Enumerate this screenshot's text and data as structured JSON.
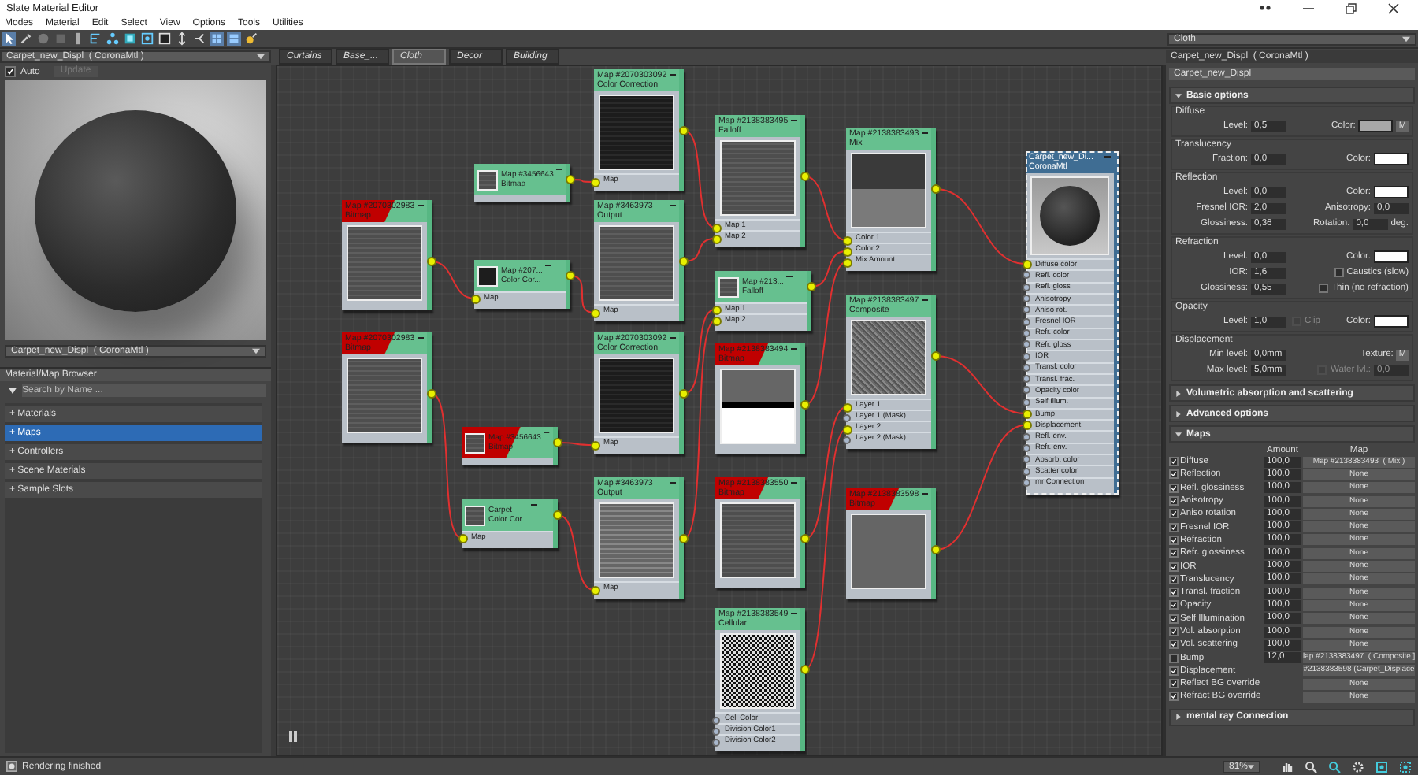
{
  "window": {
    "title": "Slate Material Editor"
  },
  "menu": [
    "Modes",
    "Material",
    "Edit",
    "Select",
    "View",
    "Options",
    "Tools",
    "Utilities"
  ],
  "view_dropdown": "Cloth",
  "material_dropdown": "Carpet_new_Displ  ( CoronaMtl )",
  "view_tabs": [
    {
      "label": "Curtains",
      "selected": false
    },
    {
      "label": "Base_...",
      "selected": false
    },
    {
      "label": "Cloth",
      "selected": true
    },
    {
      "label": "Decor",
      "selected": false
    },
    {
      "label": "Building",
      "selected": false
    }
  ],
  "preview_panel": {
    "auto": {
      "label": "Auto",
      "checked": true
    },
    "update": {
      "label": "Update",
      "disabled": true
    },
    "material_dropdown": "Carpet_new_Displ  ( CoronaMtl )"
  },
  "browser": {
    "title": "Material/Map Browser",
    "search": {
      "placeholder": "Search by Name ..."
    },
    "categories": [
      {
        "label": "+ Materials",
        "selected": false
      },
      {
        "label": "+ Maps",
        "selected": true
      },
      {
        "label": "+ Controllers",
        "selected": false
      },
      {
        "label": "+ Scene Materials",
        "selected": false
      },
      {
        "label": "+ Sample Slots",
        "selected": false
      }
    ]
  },
  "nodes": [
    {
      "title": "Map #2070303092",
      "type": "Color Correction",
      "kind": "large",
      "error": false,
      "selected": false,
      "preview": {
        "kind": "dark"
      },
      "slots": [
        {
          "label": "Map",
          "connected": true
        }
      ]
    },
    {
      "title": "Map #3456643",
      "type": "Bitmap",
      "kind": "small",
      "error": false,
      "selected": false,
      "preview": {
        "kind": "grey"
      }
    },
    {
      "title": "Map #2070302983",
      "type": "Bitmap",
      "kind": "large",
      "error": true,
      "selected": false,
      "preview": {
        "kind": "grey"
      }
    },
    {
      "title": "Map #207...",
      "type": "Color Cor...",
      "kind": "small",
      "error": false,
      "selected": false,
      "preview": {
        "kind": "black"
      },
      "slots": [
        {
          "label": "Map",
          "connected": true
        }
      ]
    },
    {
      "title": "Map #3463973",
      "type": "Output",
      "kind": "large",
      "error": false,
      "selected": false,
      "preview": {
        "kind": "grey"
      },
      "slots": [
        {
          "label": "Map",
          "connected": true
        }
      ]
    },
    {
      "title": "Map #2138383495",
      "type": "Falloff",
      "kind": "large",
      "error": false,
      "selected": false,
      "preview": {
        "kind": "grey"
      },
      "slots": [
        {
          "label": "Map 1",
          "connected": true
        },
        {
          "label": "Map 2",
          "connected": true
        }
      ]
    },
    {
      "title": "Map #213...",
      "type": "Falloff",
      "kind": "small",
      "error": false,
      "selected": false,
      "preview": {
        "kind": "grey"
      },
      "slots": [
        {
          "label": "Map 1",
          "connected": true
        },
        {
          "label": "Map 2",
          "connected": true
        }
      ]
    },
    {
      "title": "Map #2138383493",
      "type": "Mix",
      "kind": "large",
      "error": false,
      "selected": false,
      "preview": {
        "kind": "mix"
      },
      "slots": [
        {
          "label": "Color 1",
          "connected": true
        },
        {
          "label": "Color 2",
          "connected": true
        },
        {
          "label": "Mix Amount",
          "connected": true
        }
      ]
    },
    {
      "title": "Map #2070302983",
      "type": "Bitmap",
      "kind": "large",
      "error": true,
      "selected": false,
      "preview": {
        "kind": "grey"
      }
    },
    {
      "title": "Map #2070303092",
      "type": "Color Correction",
      "kind": "large",
      "error": false,
      "selected": false,
      "preview": {
        "kind": "dark"
      },
      "slots": [
        {
          "label": "Map",
          "connected": true
        }
      ]
    },
    {
      "title": "Map #2138383494",
      "type": "Bitmap",
      "kind": "large",
      "error": true,
      "selected": false,
      "preview": {
        "kind": "half"
      }
    },
    {
      "title": "Map #2138383497",
      "type": "Composite",
      "kind": "large",
      "error": false,
      "selected": false,
      "preview": {
        "kind": "noise"
      },
      "slots": [
        {
          "label": "Layer 1",
          "connected": true
        },
        {
          "label": "Layer 1 (Mask)",
          "connected": false
        },
        {
          "label": "Layer 2",
          "connected": true
        },
        {
          "label": "Layer 2 (Mask)",
          "connected": false
        }
      ]
    },
    {
      "title": "Map #3456643",
      "type": "Bitmap",
      "kind": "small",
      "error": true,
      "selected": false,
      "preview": {
        "kind": "grey"
      }
    },
    {
      "title": "Carpet",
      "type": "Color Cor...",
      "kind": "small",
      "error": false,
      "selected": false,
      "preview": {
        "kind": "grey"
      },
      "slots": [
        {
          "label": "Map",
          "connected": true
        }
      ]
    },
    {
      "title": "Map #3463973",
      "type": "Output",
      "kind": "large",
      "error": false,
      "selected": false,
      "preview": {
        "kind": "light"
      },
      "slots": [
        {
          "label": "Map",
          "connected": true
        }
      ]
    },
    {
      "title": "Map #2138383550",
      "type": "Bitmap",
      "kind": "large",
      "error": true,
      "selected": false,
      "preview": {
        "kind": "grey"
      }
    },
    {
      "title": "Map #2138383598",
      "type": "Bitmap",
      "kind": "large",
      "error": true,
      "selected": false,
      "preview": {
        "kind": "flat"
      }
    },
    {
      "title": "Map #2138383549",
      "type": "Cellular",
      "kind": "large",
      "error": false,
      "selected": false,
      "preview": {
        "kind": "cells"
      },
      "slots": [
        {
          "label": "Cell Color",
          "connected": false
        },
        {
          "label": "Division Color1",
          "connected": false
        },
        {
          "label": "Division Color2",
          "connected": false
        }
      ]
    },
    {
      "title": "Carpet_new_Di...",
      "type": "CoronaMtl",
      "kind": "material",
      "error": false,
      "selected": true,
      "preview": {
        "kind": "sphere"
      },
      "slots": [
        {
          "label": "Diffuse color",
          "connected": true
        },
        {
          "label": "Refl. color",
          "connected": false
        },
        {
          "label": "Refl. gloss",
          "connected": false
        },
        {
          "label": "Anisotropy",
          "connected": false
        },
        {
          "label": "Aniso rot.",
          "connected": false
        },
        {
          "label": "Fresnel IOR",
          "connected": false
        },
        {
          "label": "Refr. color",
          "connected": false
        },
        {
          "label": "Refr. gloss",
          "connected": false
        },
        {
          "label": "IOR",
          "connected": false
        },
        {
          "label": "Transl. color",
          "connected": false
        },
        {
          "label": "Transl. frac.",
          "connected": false
        },
        {
          "label": "Opacity color",
          "connected": false
        },
        {
          "label": "Self Illum.",
          "connected": false
        },
        {
          "label": "Bump",
          "connected": true
        },
        {
          "label": "Displacement",
          "connected": true
        },
        {
          "label": "Refl. env.",
          "connected": false
        },
        {
          "label": "Refr. env.",
          "connected": false
        },
        {
          "label": "Absorb. color",
          "connected": false
        },
        {
          "label": "Scatter color",
          "connected": false
        },
        {
          "label": "mr Connection",
          "connected": false
        }
      ]
    }
  ],
  "parameters": {
    "header": "Carpet_new_Displ  ( CoronaMtl )",
    "name": "Carpet_new_Displ",
    "basic": {
      "title": "Basic options",
      "expanded": true,
      "groups": [
        {
          "title": "Diffuse",
          "rows": [
            [
              {
                "kind": "spinner",
                "label": "Level:",
                "value": "0,5"
              },
              {
                "kind": "color",
                "label": "Color:",
                "color": "#a8a8a8",
                "map": "M"
              }
            ]
          ]
        },
        {
          "title": "Translucency",
          "rows": [
            [
              {
                "kind": "spinner",
                "label": "Fraction:",
                "value": "0,0"
              },
              {
                "kind": "color",
                "label": "Color:",
                "color": "#ffffff"
              }
            ]
          ]
        },
        {
          "title": "Reflection",
          "rows": [
            [
              {
                "kind": "spinner",
                "label": "Level:",
                "value": "0,0"
              },
              {
                "kind": "color",
                "label": "Color:",
                "color": "#ffffff"
              }
            ],
            [
              {
                "kind": "spinner",
                "label": "Fresnel IOR:",
                "value": "2,0"
              },
              {
                "kind": "spinner",
                "label": "Anisotropy:",
                "value": "0,0"
              }
            ],
            [
              {
                "kind": "spinner",
                "label": "Glossiness:",
                "value": "0,36"
              },
              {
                "kind": "spinner",
                "label": "Rotation:",
                "value": "0,0",
                "suffix": "deg."
              }
            ]
          ]
        },
        {
          "title": "Refraction",
          "rows": [
            [
              {
                "kind": "spinner",
                "label": "Level:",
                "value": "0,0"
              },
              {
                "kind": "color",
                "label": "Color:",
                "color": "#ffffff"
              }
            ],
            [
              {
                "kind": "spinner",
                "label": "IOR:",
                "value": "1,6"
              },
              {
                "kind": "check",
                "label": "Caustics (slow)",
                "checked": false,
                "disabled": false
              }
            ],
            [
              {
                "kind": "spinner",
                "label": "Glossiness:",
                "value": "0,55"
              },
              {
                "kind": "check",
                "label": "Thin (no refraction)",
                "checked": false,
                "disabled": false
              }
            ]
          ]
        },
        {
          "title": "Opacity",
          "rows": [
            [
              {
                "kind": "spinner",
                "label": "Level:",
                "value": "1,0"
              },
              {
                "kind": "check",
                "label": "Clip",
                "checked": false,
                "disabled": true
              },
              {
                "kind": "color",
                "label": "Color:",
                "color": "#ffffff"
              }
            ]
          ]
        },
        {
          "title": "Displacement",
          "rows": [
            [
              {
                "kind": "spinner",
                "label": "Min level:",
                "value": "0,0mm"
              },
              {
                "kind": "map",
                "label": "Texture:",
                "map": "M"
              }
            ],
            [
              {
                "kind": "spinner",
                "label": "Max level:",
                "value": "5,0mm"
              },
              {
                "kind": "check_spinner",
                "label": "Water lvl.:",
                "checked": false,
                "disabled": true,
                "value": "0,0"
              }
            ]
          ]
        }
      ]
    },
    "collapsed": [
      {
        "title": "Volumetric absorption and scattering",
        "expanded": false
      },
      {
        "title": "Advanced options",
        "expanded": false
      }
    ],
    "maps": {
      "title": "Maps",
      "expanded": true,
      "columns": [
        "Amount",
        "Map"
      ],
      "rows": [
        {
          "label": "Diffuse",
          "checked": true,
          "amount": "100,0",
          "map": "Map #2138383493  ( Mix )"
        },
        {
          "label": "Reflection",
          "checked": true,
          "amount": "100,0",
          "map": "None"
        },
        {
          "label": "Refl. glossiness",
          "checked": true,
          "amount": "100,0",
          "map": "None"
        },
        {
          "label": "Anisotropy",
          "checked": true,
          "amount": "100,0",
          "map": "None"
        },
        {
          "label": "Aniso rotation",
          "checked": true,
          "amount": "100,0",
          "map": "None"
        },
        {
          "label": "Fresnel IOR",
          "checked": true,
          "amount": "100,0",
          "map": "None"
        },
        {
          "label": "Refraction",
          "checked": true,
          "amount": "100,0",
          "map": "None"
        },
        {
          "label": "Refr. glossiness",
          "checked": true,
          "amount": "100,0",
          "map": "None"
        },
        {
          "label": "IOR",
          "checked": true,
          "amount": "100,0",
          "map": "None"
        },
        {
          "label": "Translucency",
          "checked": true,
          "amount": "100,0",
          "map": "None"
        },
        {
          "label": "Transl. fraction",
          "checked": true,
          "amount": "100,0",
          "map": "None"
        },
        {
          "label": "Opacity",
          "checked": true,
          "amount": "100,0",
          "map": "None"
        },
        {
          "label": "Self Illumination",
          "checked": true,
          "amount": "100,0",
          "map": "None"
        },
        {
          "label": "Vol. absorption",
          "checked": true,
          "amount": "100,0",
          "map": "None"
        },
        {
          "label": "Vol. scattering",
          "checked": true,
          "amount": "100,0",
          "map": "None"
        },
        {
          "label": "Bump",
          "checked": false,
          "amount": "12,0",
          "map": "lap #2138383497  ( Composite ]"
        },
        {
          "label": "Displacement",
          "checked": true,
          "map": "#2138383598 (Carpet_Displace"
        },
        {
          "label": "Reflect BG override",
          "checked": true,
          "map": "None"
        },
        {
          "label": "Refract BG override",
          "checked": true,
          "map": "None"
        }
      ]
    },
    "mental_ray": {
      "title": "mental ray Connection",
      "expanded": false
    }
  },
  "status_bar": {
    "message": "Rendering finished",
    "zoom": "81%"
  }
}
